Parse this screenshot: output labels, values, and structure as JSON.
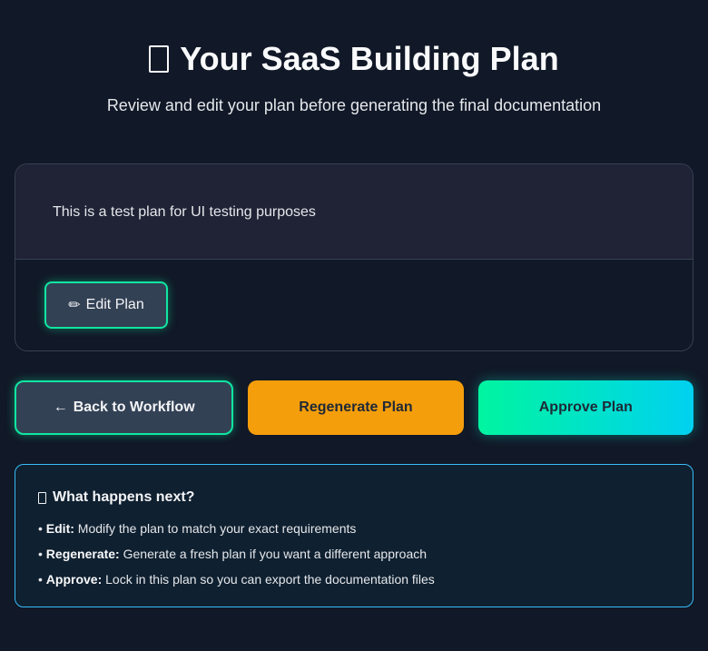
{
  "header": {
    "title": "Your SaaS Building Plan",
    "title_icon": "missing-glyph-icon",
    "subtitle": "Review and edit your plan before generating the final documentation"
  },
  "plan": {
    "content": "This is a test plan for UI testing purposes",
    "edit_button": {
      "icon": "✏",
      "label": "Edit Plan"
    }
  },
  "actions": {
    "back": {
      "arrow": "←",
      "label": "Back to Workflow"
    },
    "regenerate": {
      "label": "Regenerate Plan"
    },
    "approve": {
      "label": "Approve Plan"
    }
  },
  "info": {
    "title": "What happens next?",
    "title_icon": "missing-glyph-icon",
    "bullet": "•",
    "items": [
      {
        "term": "Edit:",
        "description": "Modify the plan to match your exact requirements"
      },
      {
        "term": "Regenerate:",
        "description": "Generate a fresh plan if you want a different approach"
      },
      {
        "term": "Approve:",
        "description": "Lock in this plan so you can export the documentation files"
      }
    ]
  },
  "colors": {
    "background": "#111827",
    "accent_green": "#10e6a0",
    "regenerate": "#f59e0b",
    "approve_gradient_start": "#00f5a0",
    "approve_gradient_end": "#00d1f0",
    "info_border": "#38bdf8"
  }
}
